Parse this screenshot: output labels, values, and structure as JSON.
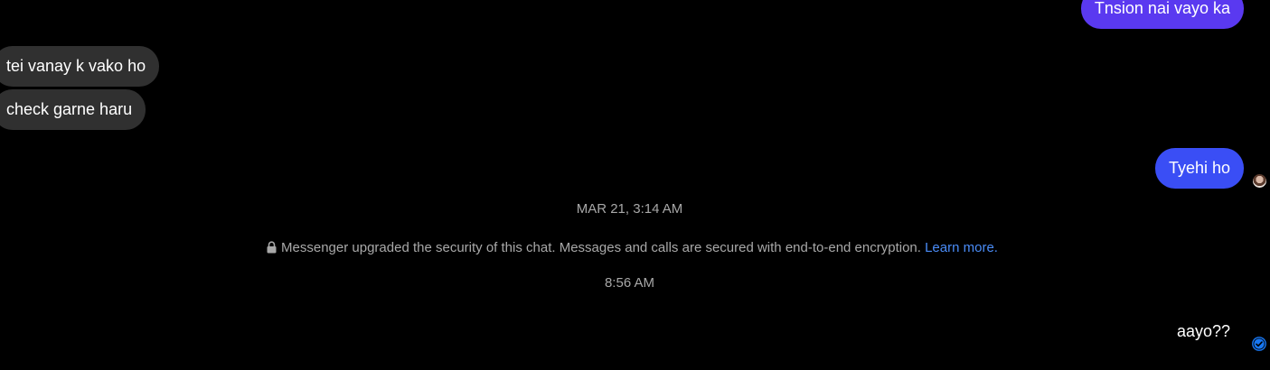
{
  "messages": {
    "out1": "Tnsion nai vayo ka",
    "in1": "tei vanay k vako ho",
    "in2": "check garne haru",
    "out2": "Tyehi ho",
    "out3": "aayo??"
  },
  "timestamps": {
    "first": "MAR 21, 3:14 AM",
    "second": "8:56 AM"
  },
  "security_notice": {
    "text": "Messenger upgraded the security of this chat. Messages and calls are secured with end-to-end encryption.",
    "link": "Learn more."
  },
  "colors": {
    "background": "#000000",
    "incoming_bubble": "#303030",
    "outgoing_bubble_1": "#5a39f0",
    "outgoing_bubble_2": "#3a4ef5",
    "link": "#4a8cf7",
    "seen_check": "#1877f2"
  },
  "icons": {
    "lock": "lock-icon",
    "seen": "check-circle-icon",
    "avatar": "avatar"
  }
}
